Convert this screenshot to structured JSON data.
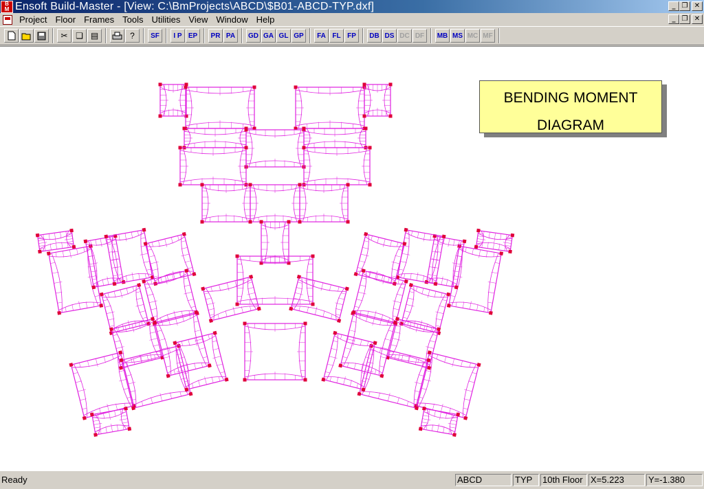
{
  "window": {
    "title": "Ensoft Build-Master - [View: C:\\BmProjects\\ABCD\\$B01-ABCD-TYP.dxf]",
    "logo_top": "B",
    "logo_bottom": "M",
    "minimize": "_",
    "restore": "❐",
    "close": "✕"
  },
  "menu": {
    "items": [
      "Project",
      "Floor",
      "Frames",
      "Tools",
      "Utilities",
      "View",
      "Window",
      "Help"
    ]
  },
  "toolbar": {
    "file_icons": [
      "new-icon",
      "open-icon",
      "save-icon",
      "cut-icon",
      "copy-icon",
      "paste-icon",
      "print-icon",
      "help-icon"
    ],
    "buttons": {
      "sf": "SF",
      "ip": "I P",
      "ep": "EP",
      "pr": "PR",
      "pa": "PA",
      "gd": "GD",
      "ga": "GA",
      "gl": "GL",
      "gp": "GP",
      "fa": "FA",
      "fl": "FL",
      "fp": "FP",
      "db": "DB",
      "ds": "DS",
      "dc": "DC",
      "df": "DF",
      "mb": "MB",
      "ms": "MS",
      "mc": "MC",
      "mf": "MF"
    }
  },
  "drawing": {
    "title_line1": "BENDING MOMENT",
    "title_line2": "DIAGRAM",
    "diagram_color": "#e020e0",
    "node_color": "#e0003a"
  },
  "status": {
    "message": "Ready",
    "project": "ABCD",
    "floor_type": "TYP",
    "floor_name": "10th Floor",
    "x_coord": "X=5.223",
    "y_coord": "Y=-1.380"
  }
}
